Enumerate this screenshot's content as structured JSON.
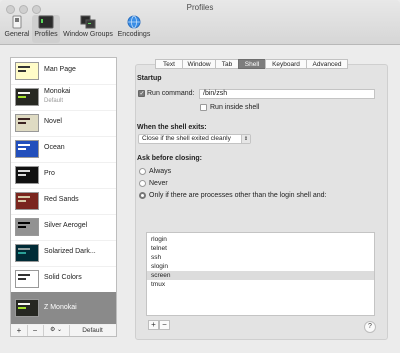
{
  "window": {
    "title": "Profiles"
  },
  "toolbar": {
    "items": [
      {
        "label": "General",
        "icon": "switch-icon"
      },
      {
        "label": "Profiles",
        "icon": "terminal-icon",
        "active": true
      },
      {
        "label": "Window Groups",
        "icon": "window-groups-icon"
      },
      {
        "label": "Encodings",
        "icon": "globe-icon"
      }
    ]
  },
  "sidebar": {
    "profiles": [
      {
        "name": "Man Page",
        "subtitle": "",
        "bg": "#fffcc8",
        "fg": "#333333"
      },
      {
        "name": "Monokai",
        "subtitle": "Default",
        "bg": "#272822",
        "fg": "#f8f8f2"
      },
      {
        "name": "Novel",
        "subtitle": "",
        "bg": "#dfdbc3",
        "fg": "#3b2322"
      },
      {
        "name": "Ocean",
        "subtitle": "",
        "bg": "#224fbc",
        "fg": "#ffffff"
      },
      {
        "name": "Pro",
        "subtitle": "",
        "bg": "#111111",
        "fg": "#dddddd"
      },
      {
        "name": "Red Sands",
        "subtitle": "",
        "bg": "#7a251e",
        "fg": "#d7c9a7"
      },
      {
        "name": "Silver Aerogel",
        "subtitle": "",
        "bg": "#929292",
        "fg": "#000000"
      },
      {
        "name": "Solarized Dark...",
        "subtitle": "",
        "bg": "#002b36",
        "fg": "#93a1a1"
      },
      {
        "name": "Solid Colors",
        "subtitle": "",
        "bg": "#ffffff",
        "fg": "#333333"
      },
      {
        "name": "Z Monokai",
        "subtitle": "",
        "bg": "#272822",
        "fg": "#f8f8f2",
        "selected": true
      }
    ],
    "add_label": "+",
    "remove_label": "−",
    "gear_label": "⚙ ⌄",
    "default_label": "Default"
  },
  "tabs": [
    {
      "label": "Text"
    },
    {
      "label": "Window"
    },
    {
      "label": "Tab"
    },
    {
      "label": "Shell",
      "active": true
    },
    {
      "label": "Keyboard"
    },
    {
      "label": "Advanced"
    }
  ],
  "startup": {
    "heading": "Startup",
    "run_command_label": "Run command:",
    "run_command_value": "/bin/zsh",
    "run_inside_shell_label": "Run inside shell"
  },
  "shell_exits": {
    "heading": "When the shell exits:",
    "selected": "Close if the shell exited cleanly"
  },
  "ask_before_closing": {
    "heading": "Ask before closing:",
    "options": [
      "Always",
      "Never",
      "Only if there are processes other than the login shell and:"
    ],
    "processes": [
      "rlogin",
      "telnet",
      "ssh",
      "slogin",
      "screen",
      "tmux"
    ],
    "selected_process": "screen",
    "add_label": "+",
    "remove_label": "−"
  },
  "help_label": "?"
}
